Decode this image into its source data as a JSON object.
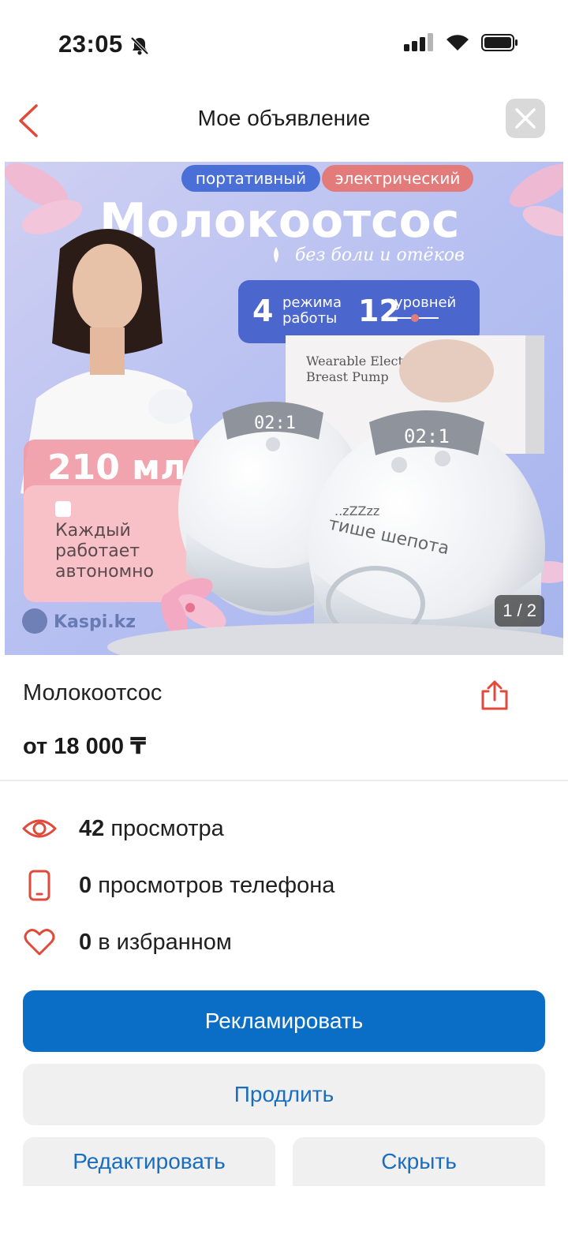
{
  "status_bar": {
    "time": "23:05",
    "icons": [
      "bell-off-icon",
      "signal-icon",
      "wifi-icon",
      "battery-icon"
    ]
  },
  "nav": {
    "title": "Мое объявление",
    "back_icon": "chevron-left-icon",
    "close_icon": "close-icon",
    "accent_color": "#e04a3b"
  },
  "image": {
    "counter": "1 / 2",
    "badges": [
      "портативный",
      "электрический"
    ],
    "headline": "Молокоотсос",
    "tagline": "без боли и отёков",
    "modes_number": "4",
    "modes_label": "режима работы",
    "levels_number": "12",
    "levels_label": "уровней",
    "box_text_1": "Wearable Electric",
    "box_text_2": "Breast Pump",
    "volume": "210 мл",
    "autonomous_text": "Каждый работает автономно",
    "quiet_text": "тише шепота",
    "zzz": "..zZZzz",
    "display_digits": "02:1",
    "watermark": "Kaspi.kz"
  },
  "product": {
    "title": "Молокоотсос",
    "price": "от 18 000 ₸",
    "share_icon": "share-icon"
  },
  "stats": [
    {
      "icon": "eye-icon",
      "count": "42",
      "label": " просмотра"
    },
    {
      "icon": "phone-icon",
      "count": "0",
      "label": " просмотров телефона"
    },
    {
      "icon": "heart-icon",
      "count": "0",
      "label": " в избранном"
    }
  ],
  "actions": {
    "promote": "Рекламировать",
    "extend": "Продлить",
    "edit": "Редактировать",
    "hide": "Скрыть",
    "primary_color": "#0a6ec7",
    "secondary_text_color": "#1a6ec0"
  }
}
